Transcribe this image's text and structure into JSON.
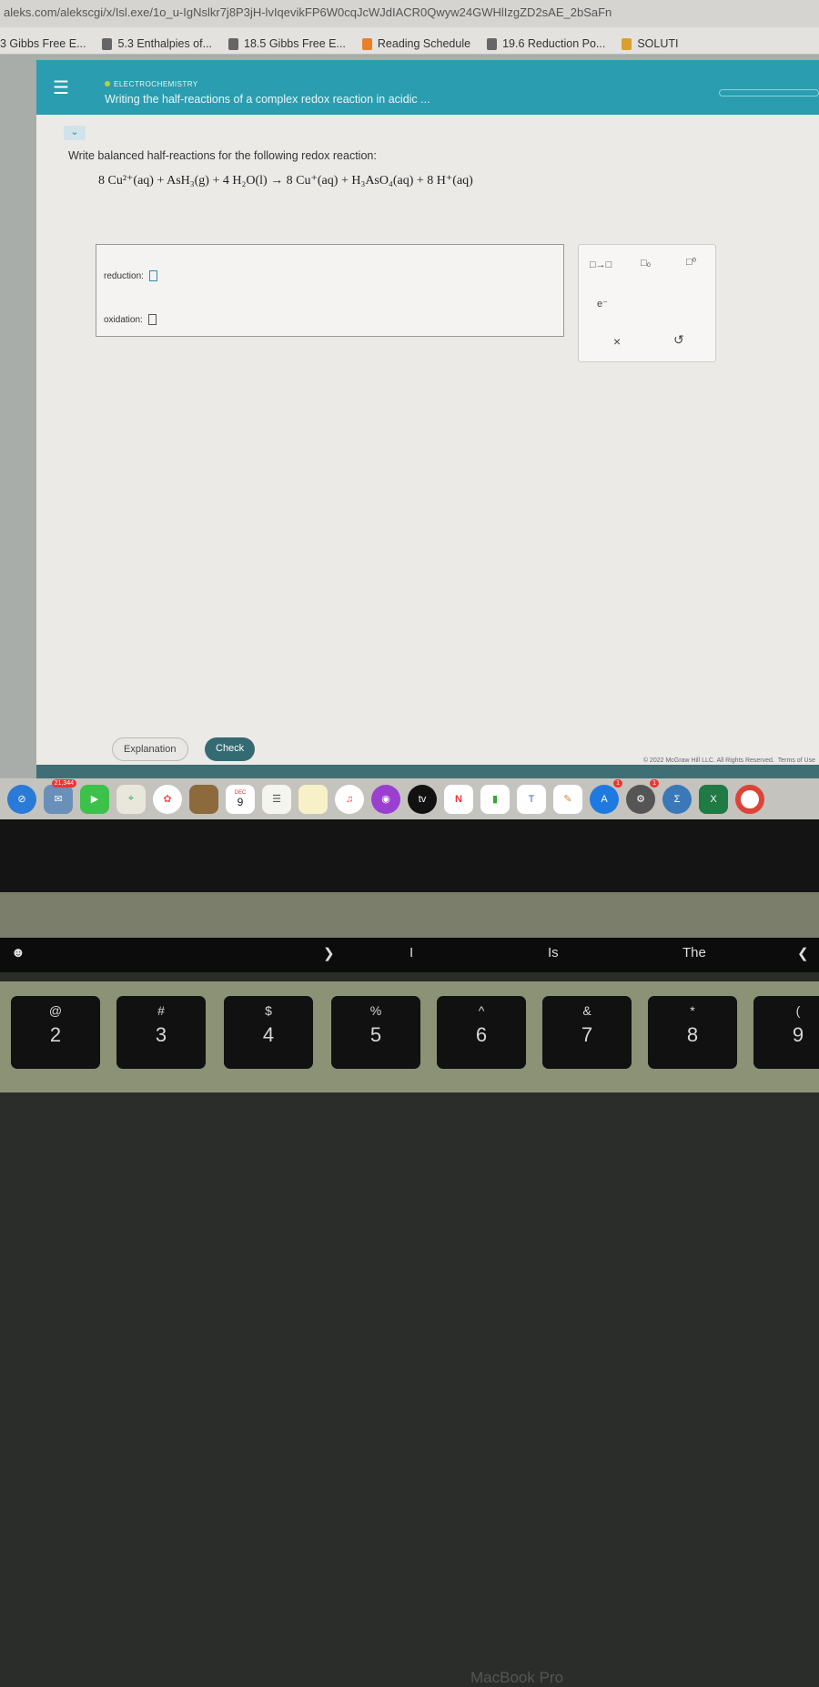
{
  "browser": {
    "url": "aleks.com/alekscgi/x/Isl.exe/1o_u-IgNslkr7j8P3jH-lvIqevikFP6W0cqJcWJdIACR0Qwyw24GWHlIzgZD2sAE_2bSaFn",
    "bookmarks": [
      {
        "label": "3 Gibbs Free E..."
      },
      {
        "label": "5.3 Enthalpies of..."
      },
      {
        "label": "18.5 Gibbs Free E..."
      },
      {
        "label": "Reading Schedule"
      },
      {
        "label": "19.6 Reduction Po..."
      },
      {
        "label": "SOLUTI"
      }
    ]
  },
  "header": {
    "category": "ELECTROCHEMISTRY",
    "title": "Writing the half-reactions of a complex redox reaction in acidic ...",
    "menu_icon": "hamburger-icon",
    "accent": "#2a9db0"
  },
  "question": {
    "prompt": "Write balanced half-reactions for the following redox reaction:",
    "equation": {
      "reactants": "8 Cu²⁺(aq) + AsH₃(g) + 4 H₂O(l)",
      "arrow": "→",
      "products": "8 Cu⁺(aq) + H₃AsO₄(aq) + 8 H⁺(aq)"
    }
  },
  "answer": {
    "reduction_label": "reduction:",
    "oxidation_label": "oxidation:",
    "reduction_value": "",
    "oxidation_value": ""
  },
  "palette": {
    "arrow": "□→□",
    "subscript": "□₀",
    "superscript": "□⁰",
    "electron": "e⁻",
    "clear": "×",
    "undo": "↺"
  },
  "buttons": {
    "explanation": "Explanation",
    "check": "Check"
  },
  "footer": {
    "copyright": "© 2022 McGraw Hill LLC. All Rights Reserved.",
    "terms": "Terms of Use"
  },
  "dock": {
    "mail_badge": "21,344",
    "calendar_month": "DEC",
    "calendar_day": "9",
    "tv": "tv",
    "appstore_badge": "1",
    "settings_badge": "1"
  },
  "bezel": {
    "label": "MacBook Pro"
  },
  "touchbar": {
    "suggestions": [
      "I",
      "Is",
      "The"
    ],
    "open": "❯",
    "close": "❮"
  },
  "keys": [
    {
      "s": "@",
      "n": "2"
    },
    {
      "s": "#",
      "n": "3"
    },
    {
      "s": "$",
      "n": "4"
    },
    {
      "s": "%",
      "n": "5"
    },
    {
      "s": "^",
      "n": "6"
    },
    {
      "s": "&",
      "n": "7"
    },
    {
      "s": "*",
      "n": "8"
    },
    {
      "s": "(",
      "n": "9"
    }
  ]
}
